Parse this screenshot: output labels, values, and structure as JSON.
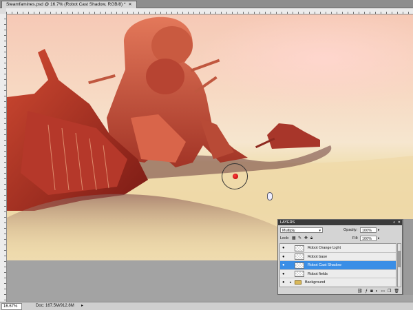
{
  "document": {
    "tab_title": "Steamfamines.psd @ 16.7% (Robot Cast Shadow, RGB/8) *",
    "close_icon": "close-icon"
  },
  "status": {
    "zoom": "16.67%",
    "doc_size": "Doc: 167.5M/912.8M",
    "arrow": "▸"
  },
  "layers_panel": {
    "title": "LAYERS",
    "blend_mode": "Multiply",
    "opacity_label": "Opacity:",
    "opacity_value": "100%",
    "lock_label": "Lock:",
    "fill_label": "Fill:",
    "fill_value": "100%",
    "layers": [
      {
        "name": "Robot Orange Light",
        "visible": true,
        "selected": false,
        "type": "layer"
      },
      {
        "name": "Robot base",
        "visible": true,
        "selected": false,
        "type": "layer"
      },
      {
        "name": "Robot Cast Shadow",
        "visible": true,
        "selected": true,
        "type": "layer"
      },
      {
        "name": "Robot fields",
        "visible": true,
        "selected": false,
        "type": "layer"
      },
      {
        "name": "Background",
        "visible": true,
        "selected": false,
        "type": "group"
      }
    ],
    "footer_icons": [
      "link-icon",
      "fx-icon",
      "mask-icon",
      "adjustment-icon",
      "new-group-icon",
      "new-layer-icon",
      "trash-icon"
    ]
  },
  "colors": {
    "selection": "#3a8ee6",
    "brush_color": "#d01010"
  }
}
